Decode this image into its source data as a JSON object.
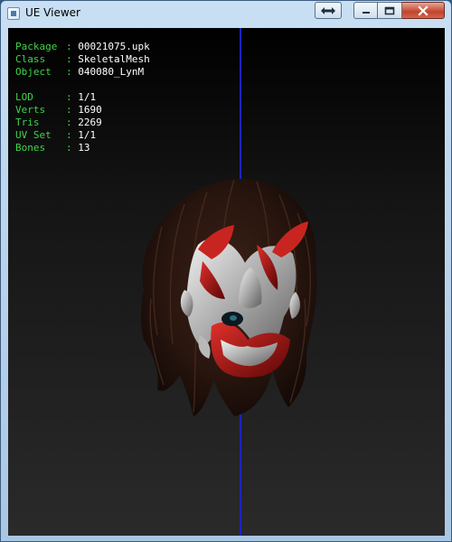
{
  "window": {
    "title": "UE Viewer"
  },
  "info": {
    "package": {
      "label": "Package",
      "value": "00021075.upk"
    },
    "class": {
      "label": "Class",
      "value": "SkeletalMesh"
    },
    "object": {
      "label": "Object",
      "value": "040080_LynM"
    },
    "lod": {
      "label": "LOD",
      "value": "1/1"
    },
    "verts": {
      "label": "Verts",
      "value": "1690"
    },
    "tris": {
      "label": "Tris",
      "value": "2269"
    },
    "uvset": {
      "label": "UV Set",
      "value": "1/1"
    },
    "bones": {
      "label": "Bones",
      "value": "13"
    }
  },
  "colors": {
    "label": "#3fd44a",
    "value": "#ffffff",
    "axis": "#1c25c0",
    "background": "#1a1a1a"
  }
}
